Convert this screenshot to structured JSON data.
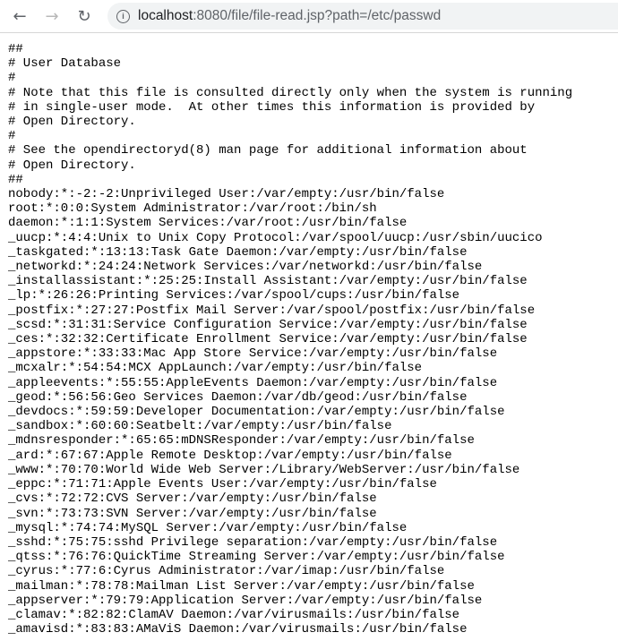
{
  "browser": {
    "url_host": "localhost",
    "url_rest": ":8080/file/file-read.jsp?path=/etc/passwd",
    "icons": {
      "back": "arrow-left",
      "forward": "arrow-right",
      "reload": "reload",
      "info": "info-circle"
    }
  },
  "file_lines": [
    "##",
    "# User Database",
    "#",
    "# Note that this file is consulted directly only when the system is running",
    "# in single-user mode.  At other times this information is provided by",
    "# Open Directory.",
    "#",
    "# See the opendirectoryd(8) man page for additional information about",
    "# Open Directory.",
    "##",
    "nobody:*:-2:-2:Unprivileged User:/var/empty:/usr/bin/false",
    "root:*:0:0:System Administrator:/var/root:/bin/sh",
    "daemon:*:1:1:System Services:/var/root:/usr/bin/false",
    "_uucp:*:4:4:Unix to Unix Copy Protocol:/var/spool/uucp:/usr/sbin/uucico",
    "_taskgated:*:13:13:Task Gate Daemon:/var/empty:/usr/bin/false",
    "_networkd:*:24:24:Network Services:/var/networkd:/usr/bin/false",
    "_installassistant:*:25:25:Install Assistant:/var/empty:/usr/bin/false",
    "_lp:*:26:26:Printing Services:/var/spool/cups:/usr/bin/false",
    "_postfix:*:27:27:Postfix Mail Server:/var/spool/postfix:/usr/bin/false",
    "_scsd:*:31:31:Service Configuration Service:/var/empty:/usr/bin/false",
    "_ces:*:32:32:Certificate Enrollment Service:/var/empty:/usr/bin/false",
    "_appstore:*:33:33:Mac App Store Service:/var/empty:/usr/bin/false",
    "_mcxalr:*:54:54:MCX AppLaunch:/var/empty:/usr/bin/false",
    "_appleevents:*:55:55:AppleEvents Daemon:/var/empty:/usr/bin/false",
    "_geod:*:56:56:Geo Services Daemon:/var/db/geod:/usr/bin/false",
    "_devdocs:*:59:59:Developer Documentation:/var/empty:/usr/bin/false",
    "_sandbox:*:60:60:Seatbelt:/var/empty:/usr/bin/false",
    "_mdnsresponder:*:65:65:mDNSResponder:/var/empty:/usr/bin/false",
    "_ard:*:67:67:Apple Remote Desktop:/var/empty:/usr/bin/false",
    "_www:*:70:70:World Wide Web Server:/Library/WebServer:/usr/bin/false",
    "_eppc:*:71:71:Apple Events User:/var/empty:/usr/bin/false",
    "_cvs:*:72:72:CVS Server:/var/empty:/usr/bin/false",
    "_svn:*:73:73:SVN Server:/var/empty:/usr/bin/false",
    "_mysql:*:74:74:MySQL Server:/var/empty:/usr/bin/false",
    "_sshd:*:75:75:sshd Privilege separation:/var/empty:/usr/bin/false",
    "_qtss:*:76:76:QuickTime Streaming Server:/var/empty:/usr/bin/false",
    "_cyrus:*:77:6:Cyrus Administrator:/var/imap:/usr/bin/false",
    "_mailman:*:78:78:Mailman List Server:/var/empty:/usr/bin/false",
    "_appserver:*:79:79:Application Server:/var/empty:/usr/bin/false",
    "_clamav:*:82:82:ClamAV Daemon:/var/virusmails:/usr/bin/false",
    "_amavisd:*:83:83:AMaViS Daemon:/var/virusmails:/usr/bin/false"
  ]
}
